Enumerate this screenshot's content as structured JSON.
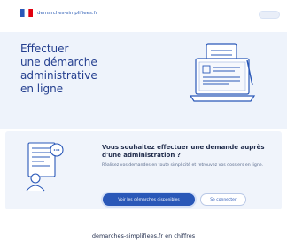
{
  "header": {
    "brand_text": "demarches-simplifiees.fr"
  },
  "hero": {
    "title_lines": [
      "Effectuer",
      "une démarche",
      "administrative",
      "en ligne"
    ]
  },
  "card": {
    "title": "Vous souhaitez effectuer une demande auprès d'une administration ?",
    "text": "Réalisez vos demandes en toute simplicité et retrouvez vos dossiers en ligne.",
    "primary_button": "Voir les démarches disponibles",
    "secondary_button": "Se connecter"
  },
  "stats": {
    "title": "demarches-simplifiees.fr en chiffres"
  },
  "colors": {
    "primary": "#2a58b8",
    "hero_title": "#243f8f",
    "hero_bg": "#eef3fb",
    "card_bg": "#f0f4fb"
  },
  "icons": {
    "flag": "french-flag-icon",
    "hero": "laptop-document-illustration",
    "card": "form-user-illustration"
  }
}
